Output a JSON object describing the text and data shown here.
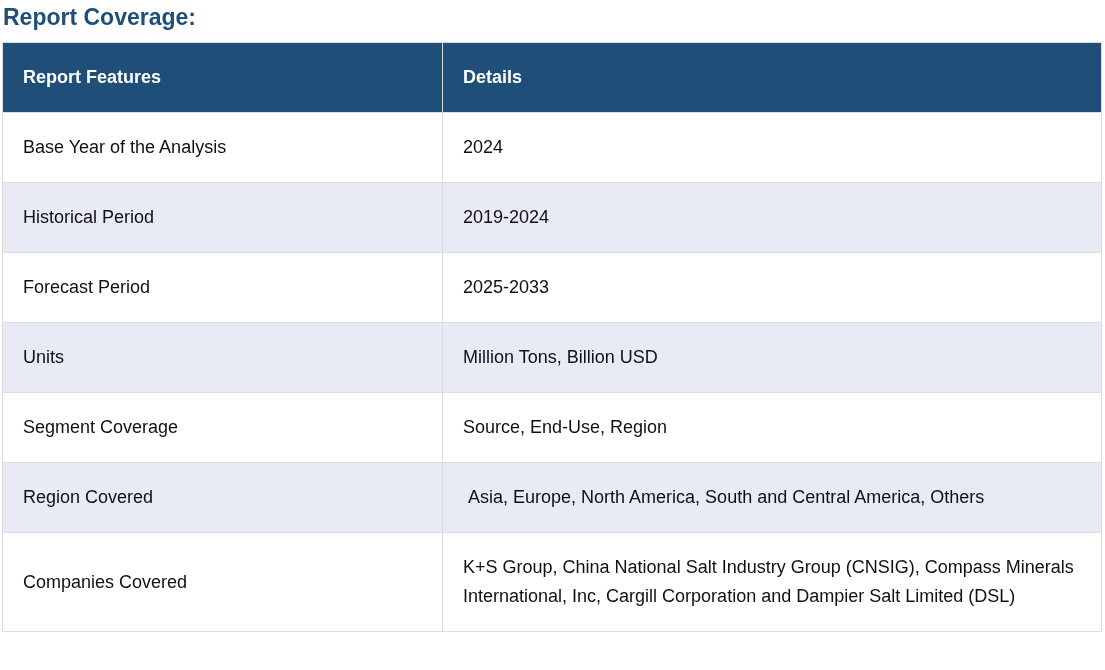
{
  "title": "Report Coverage:",
  "table": {
    "columns": [
      "Report Features",
      "Details"
    ],
    "rows": [
      {
        "feature": "Base Year of the Analysis",
        "details": "2024"
      },
      {
        "feature": "Historical Period",
        "details": "2019-2024"
      },
      {
        "feature": "Forecast Period",
        "details": "2025-2033"
      },
      {
        "feature": "Units",
        "details": "Million Tons, Billion USD"
      },
      {
        "feature": "Segment Coverage",
        "details": "Source, End-Use, Region"
      },
      {
        "feature": "Region Covered",
        "details": " Asia, Europe, North America, South and Central America, Others"
      },
      {
        "feature": "Companies Covered",
        "details": "K+S Group, China National Salt Industry Group (CNSIG), Compass Minerals International, Inc, Cargill Corporation and Dampier Salt Limited (DSL)"
      }
    ]
  }
}
